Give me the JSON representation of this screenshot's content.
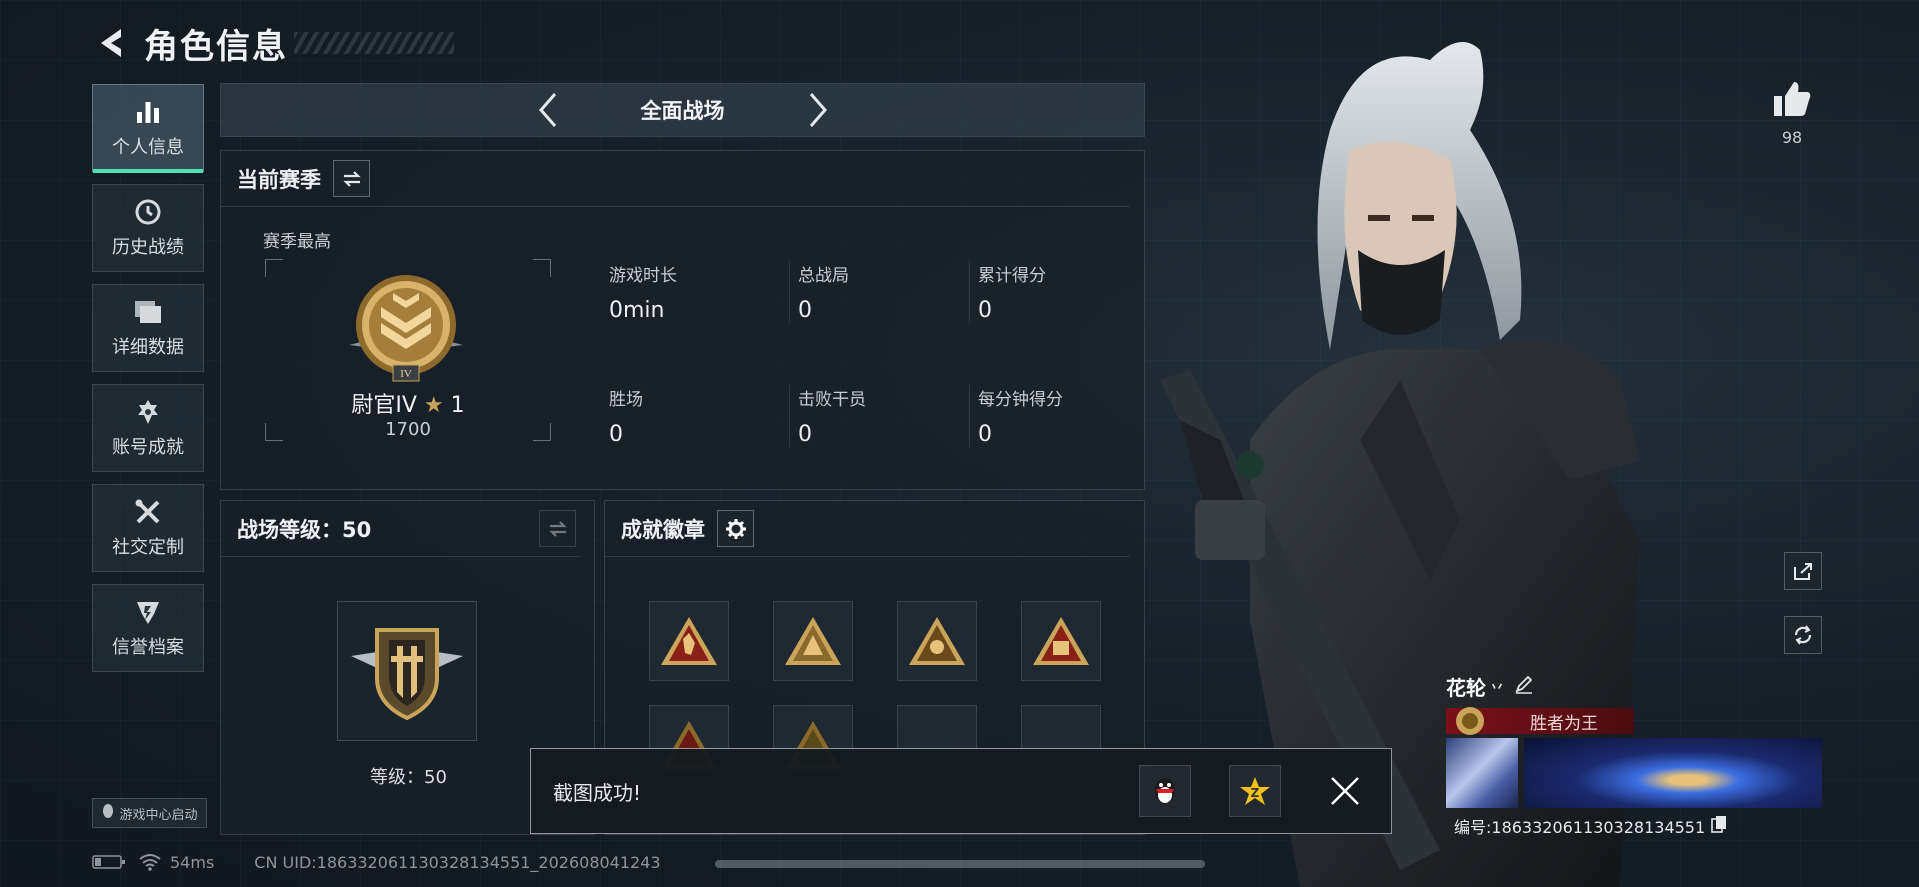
{
  "header": {
    "title": "角色信息"
  },
  "nav": {
    "items": [
      {
        "label": "个人信息",
        "active": true,
        "icon": "bar-chart-icon"
      },
      {
        "label": "历史战绩",
        "active": false,
        "icon": "clock-icon"
      },
      {
        "label": "详细数据",
        "active": false,
        "icon": "folder-icon"
      },
      {
        "label": "账号成就",
        "active": false,
        "icon": "achievement-icon"
      },
      {
        "label": "社交定制",
        "active": false,
        "icon": "tools-icon"
      },
      {
        "label": "信誉档案",
        "active": false,
        "icon": "credit-shield-icon"
      }
    ],
    "game_center": "游戏中心启动"
  },
  "mode": {
    "title": "全面战场"
  },
  "season": {
    "title": "当前赛季",
    "best_label": "赛季最高",
    "rank_name": "尉官IV",
    "rank_stars": "1",
    "rank_score": "1700",
    "stats": [
      {
        "label": "游戏时长",
        "value": "0min"
      },
      {
        "label": "总战局",
        "value": "0"
      },
      {
        "label": "累计得分",
        "value": "0"
      },
      {
        "label": "胜场",
        "value": "0"
      },
      {
        "label": "击败干员",
        "value": "0"
      },
      {
        "label": "每分钟得分",
        "value": "0"
      }
    ]
  },
  "battlefield_level": {
    "title": "战场等级：50",
    "level_text": "等级：50"
  },
  "achievements": {
    "title": "成就徽章"
  },
  "toast": {
    "text": "截图成功!"
  },
  "status_bar": {
    "ping": "54ms",
    "uid_line": "CN UID:1863320611303281​34551_20260804124​3"
  },
  "profile": {
    "likes": "98",
    "name": "花轮",
    "name_suffix": "丷",
    "title_tag": "胜者为王",
    "id_line": "编号:18633206113032813​4551"
  },
  "colors": {
    "accent": "#4be3b0",
    "gold": "#c9a45a",
    "title_red": "#7a1118"
  }
}
